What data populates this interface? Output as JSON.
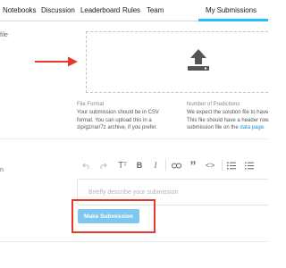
{
  "nav": {
    "items": [
      "Notebooks",
      "Discussion",
      "Leaderboard",
      "Rules",
      "Team"
    ],
    "active": "My Submissions"
  },
  "upload": {
    "section_label": "file",
    "format_title": "File Format",
    "format_lines": [
      "Your submission should be in CSV",
      "format. You can upload this in a",
      "zip/gz/rar/7z archive, if you prefer."
    ],
    "predictions_title": "Number of Predictions",
    "predictions_lines": [
      "We expect the solution file to have",
      "This file should have a header row.",
      "submission file on the "
    ],
    "predictions_link": "data page."
  },
  "description": {
    "section_label": "n",
    "placeholder": "Briefly describe your submission"
  },
  "toolbar": {
    "icons": [
      "undo-icon",
      "redo-icon",
      "text-size-icon",
      "bold-icon",
      "italic-icon",
      "list-icon",
      "link-icon",
      "quote-icon",
      "code-icon",
      "numbered-list-icon",
      "bulleted-list-icon"
    ],
    "labels": {
      "text_size": "T",
      "bold": "B",
      "italic": "I",
      "quote": "”",
      "code": "<>"
    }
  },
  "submit": {
    "label": "Make Submission"
  },
  "colors": {
    "accent": "#20beff",
    "button": "#7ec8f0",
    "highlight": "#e53a2a",
    "arrow": "#e53a2a",
    "link": "#1a8fd6"
  }
}
